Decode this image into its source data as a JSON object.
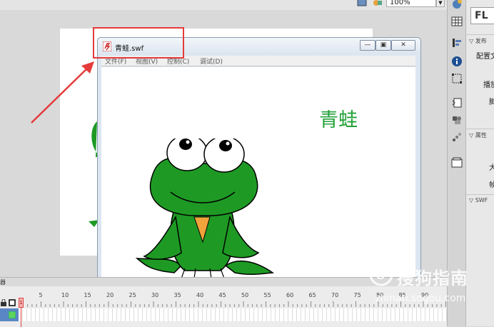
{
  "stage": {
    "zoom_value": "100%",
    "zoom_arrow": "▼"
  },
  "player": {
    "title": "青蛙.swf",
    "minimize_icon": "minimize-icon",
    "maximize_icon": "maximize-icon",
    "close_icon": "close-icon",
    "minimize_glyph": "—",
    "maximize_glyph": "▣",
    "close_glyph": "✕",
    "menu": {
      "file": "文件(F)",
      "view": "视图(V)",
      "control": "控制(C)",
      "debug": "调试(D)"
    },
    "content_title": "青蛙"
  },
  "props_panel": {
    "header": "FL",
    "publish_section": "▽ 发布",
    "profile_label": "配置文",
    "player_label": "播放",
    "script_label": "脚",
    "attributes_section": "▽ 属性",
    "size_label": "大",
    "fps_label": "帧",
    "swf_section": "▽ SWF"
  },
  "timeline": {
    "header_label": "器",
    "playhead_frame": "1",
    "ticks": [
      "5",
      "10",
      "15",
      "20",
      "25",
      "30",
      "35",
      "40",
      "45",
      "50",
      "55",
      "60",
      "65",
      "70",
      "75",
      "80",
      "85",
      "90"
    ]
  },
  "watermark": {
    "text": "搜狗指南",
    "url": "zhinan.sogou.com"
  },
  "colors": {
    "frog_green": "#1e9a24",
    "title_green": "#23a23a",
    "annotation_red": "#e53b3b"
  }
}
